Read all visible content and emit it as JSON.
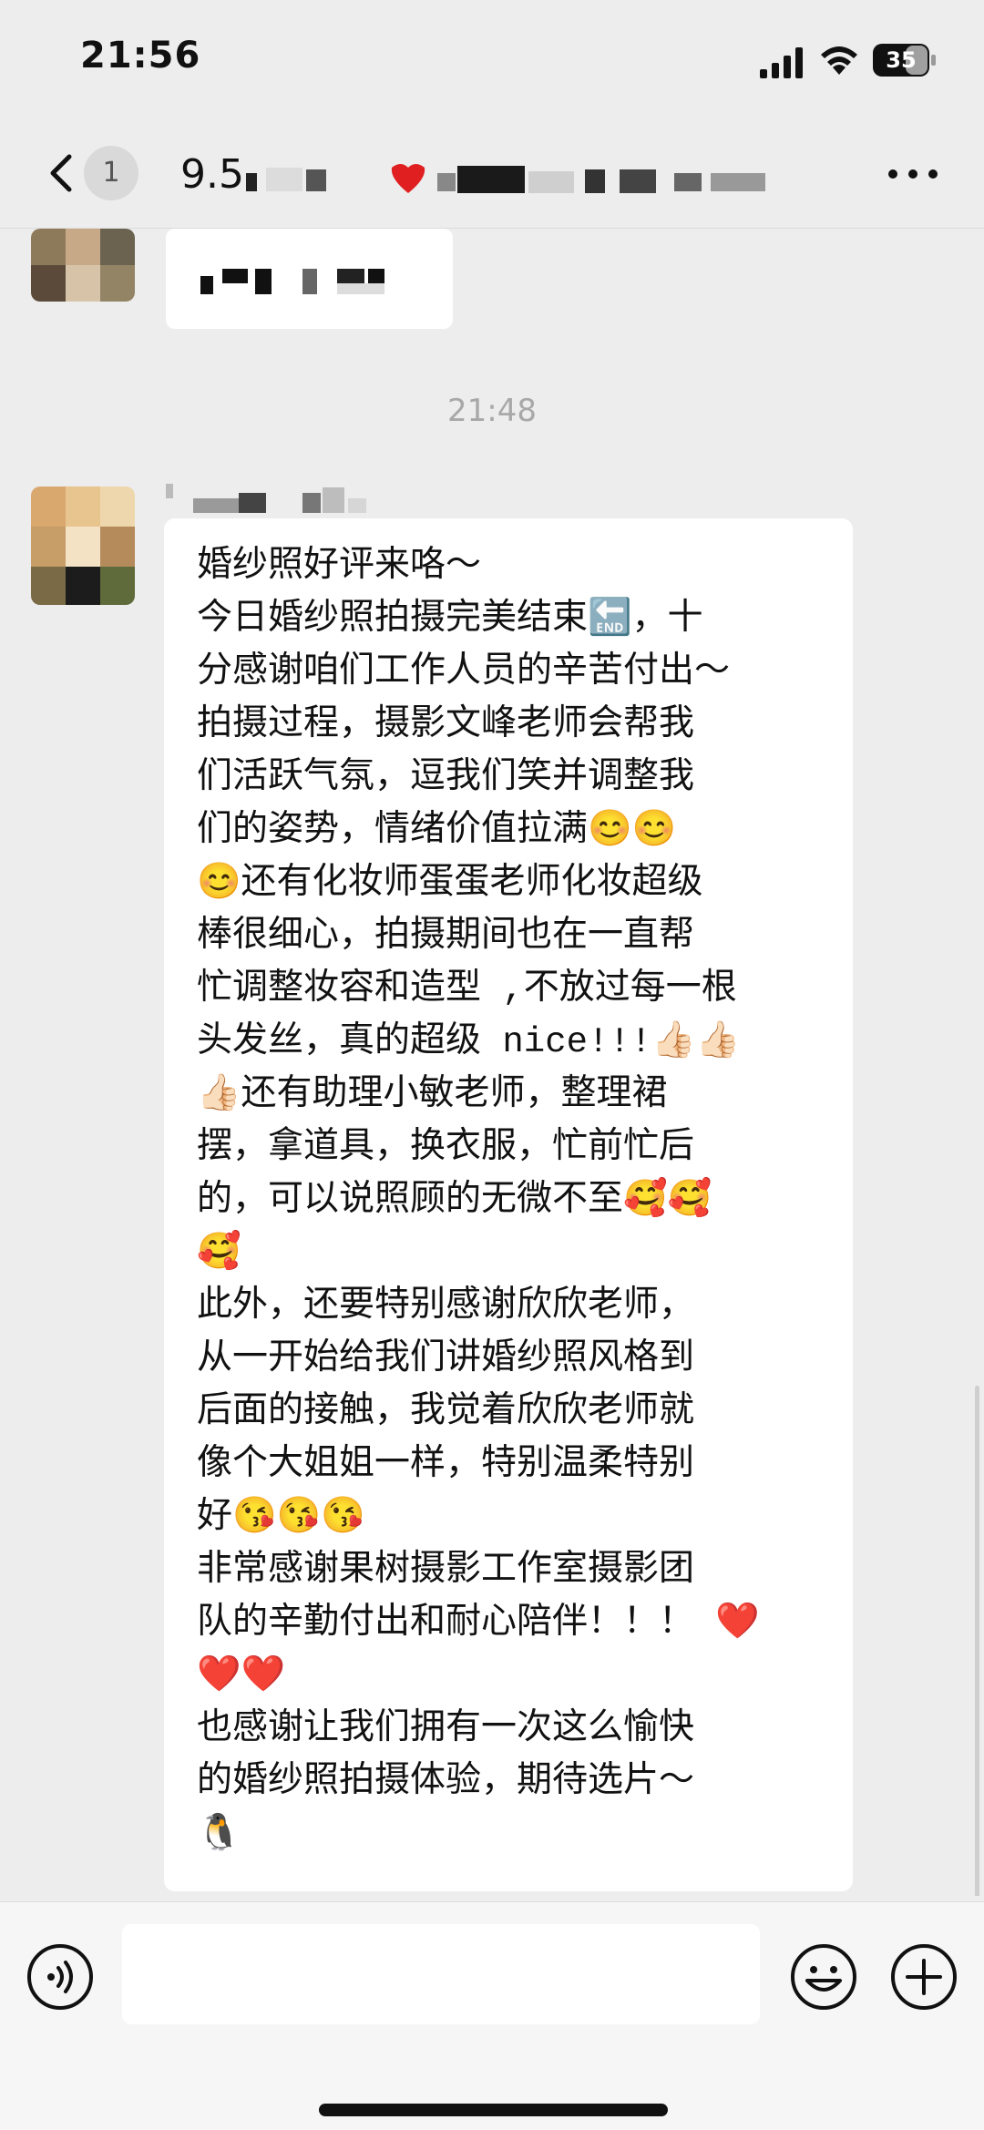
{
  "status_bar": {
    "time": "21:56",
    "battery_level": "35",
    "icons": [
      "signal-icon",
      "wifi-icon",
      "battery-icon"
    ]
  },
  "nav_bar": {
    "unread_count": "1",
    "title_visible": "9.5",
    "icons": [
      "back-arrow-icon",
      "more-dots-icon"
    ]
  },
  "chat": {
    "timestamp": "21:48",
    "message_lines": [
      "婚纱照好评来咯～",
      "今日婚纱照拍摄完美结束🔚，十",
      "分感谢咱们工作人员的辛苦付出～",
      "拍摄过程，摄影文峰老师会帮我",
      "们活跃气氛，逗我们笑并调整我",
      "们的姿势，情绪价值拉满😊😊",
      "😊还有化妆师蛋蛋老师化妆超级",
      "棒很细心，拍摄期间也在一直帮",
      "忙调整妆容和造型 ,不放过每一根",
      "头发丝，真的超级 nice!!!👍🏻👍🏻",
      "👍🏻还有助理小敏老师，整理裙",
      "摆，拿道具，换衣服，忙前忙后",
      "的，可以说照顾的无微不至🥰🥰",
      "🥰",
      "此外，还要特别感谢欣欣老师，",
      "从一开始给我们讲婚纱照风格到",
      "后面的接触，我觉着欣欣老师就",
      "像个大姐姐一样，特别温柔特别",
      "好😘😘😘",
      "非常感谢果树摄影工作室摄影团",
      "队的辛勤付出和耐心陪伴！！！ ❤️",
      "❤️❤️",
      "也感谢让我们拥有一次这么愉快",
      "的婚纱照拍摄体验，期待选片～",
      "🐧"
    ]
  },
  "input_bar": {
    "icons": [
      "voice-icon",
      "emoji-icon",
      "add-icon"
    ]
  },
  "colors": {
    "background": "#ededed",
    "bubble": "#ffffff",
    "timestamp": "#a8a8a8",
    "input_bar": "#f6f6f6"
  }
}
